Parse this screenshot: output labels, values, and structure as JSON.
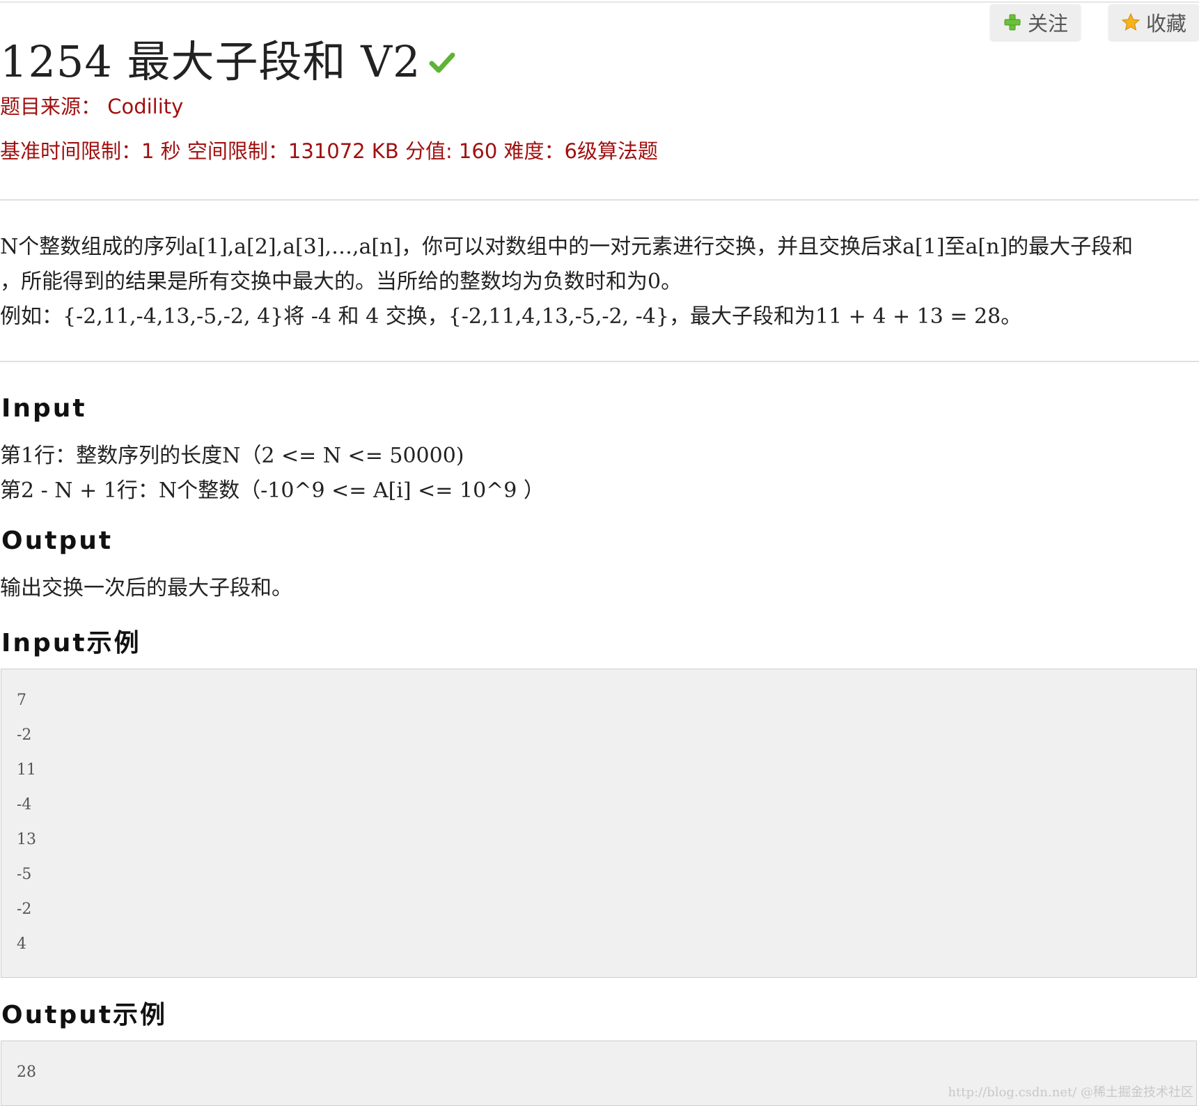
{
  "toolbar": {
    "follow_label": "关注",
    "favorite_label": "收藏"
  },
  "problem": {
    "title": "1254 最大子段和 V2",
    "source": "题目来源： Codility",
    "limits": "基准时间限制：1 秒 空间限制：131072 KB 分值: 160 难度：6级算法题"
  },
  "description": {
    "lines": [
      "N个整数组成的序列a[1],a[2],a[3],…,a[n]，你可以对数组中的一对元素进行交换，并且交换后求a[1]至a[n]的最大子段和",
      "，所能得到的结果是所有交换中最大的。当所给的整数均为负数时和为0。",
      "例如：{-2,11,-4,13,-5,-2, 4}将 -4 和 4 交换，{-2,11,4,13,-5,-2, -4}，最大子段和为11 + 4 + 13 = 28。"
    ]
  },
  "input_section": {
    "heading": "Input",
    "lines": [
      "第1行：整数序列的长度N（2 <= N <= 50000)",
      "第2 - N + 1行：N个整数（-10^9 <= A[i] <= 10^9 ）"
    ]
  },
  "output_section": {
    "heading": "Output",
    "line": "输出交换一次后的最大子段和。"
  },
  "input_example": {
    "heading": "Input示例",
    "lines": [
      "7",
      "-2",
      "11",
      "-4",
      "13",
      "-5",
      "-2",
      "4"
    ]
  },
  "output_example": {
    "heading": "Output示例",
    "lines": [
      "28"
    ]
  },
  "watermark": "http://blog.csdn.net/ @稀土掘金技术社区",
  "colors": {
    "accent_red": "#a01010",
    "code_bg": "#f0f0f0"
  },
  "icons": {
    "follow": "plus-icon",
    "favorite": "star-icon",
    "accepted": "check-icon"
  }
}
